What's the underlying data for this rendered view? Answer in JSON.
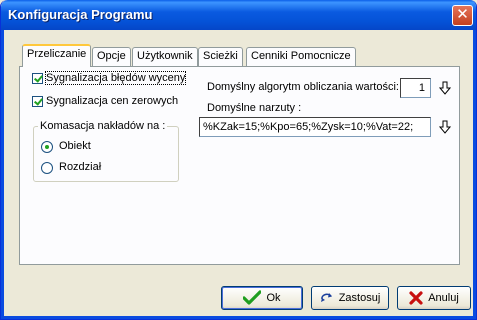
{
  "window": {
    "title": "Konfiguracja Programu",
    "close_glyph": "✕"
  },
  "tabs": [
    {
      "label": "Przeliczanie",
      "active": true
    },
    {
      "label": "Opcje",
      "active": false
    },
    {
      "label": "Użytkownik",
      "active": false
    },
    {
      "label": "Scieżki",
      "active": false
    },
    {
      "label": "Cenniki Pomocnicze",
      "active": false
    }
  ],
  "checkboxes": [
    {
      "label": "Sygnalizacja błędów wyceny",
      "checked": true
    },
    {
      "label": "Sygnalizacja cen zerowych",
      "checked": true
    }
  ],
  "komasacja": {
    "title": "Komasacja nakładów na :",
    "options": [
      {
        "label": "Obiekt",
        "selected": true
      },
      {
        "label": "Rozdział",
        "selected": false
      }
    ]
  },
  "algorithm": {
    "label": "Domyślny algorytm obliczania wartości:",
    "value": "1",
    "icon": "arrow-down-icon"
  },
  "narzuty": {
    "label": "Domyślne narzuty :",
    "value": "%KZak=15;%Kpo=65;%Zysk=10;%Vat=22;",
    "icon": "arrow-down-icon"
  },
  "buttons": {
    "ok": {
      "label": "Ok",
      "icon": "checkmark-icon",
      "icon_color": "#1f9e1f"
    },
    "apply": {
      "label": "Zastosuj",
      "icon": "refresh-icon"
    },
    "cancel": {
      "label": "Anuluj",
      "icon": "x-icon",
      "icon_color": "#c81010"
    }
  },
  "colors": {
    "titlebar": "#0553d8",
    "check": "#21a121",
    "tab_highlight": "#ffc83c"
  }
}
